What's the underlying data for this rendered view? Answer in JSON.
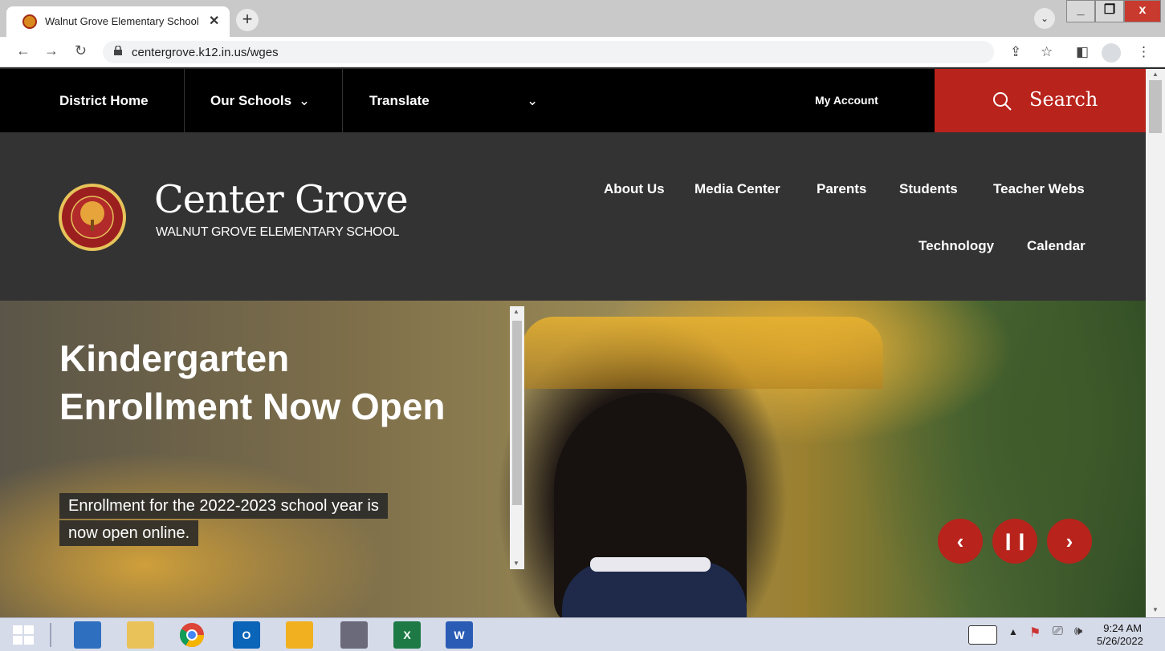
{
  "browser": {
    "tab_title": "Walnut Grove Elementary School",
    "tab_close": "✕",
    "new_tab": "+",
    "url": "centergrove.k12.in.us/wges"
  },
  "topbar": {
    "district_home": "District Home",
    "our_schools": "Our Schools",
    "translate": "Translate",
    "my_account": "My Account",
    "search": "Search"
  },
  "header": {
    "brand": "Center Grove",
    "subtitle": "WALNUT GROVE ELEMENTARY SCHOOL",
    "nav": {
      "about_us": "About Us",
      "media_center": "Media Center",
      "parents": "Parents",
      "students": "Students",
      "teacher_webs": "Teacher Webs",
      "technology": "Technology",
      "calendar": "Calendar"
    }
  },
  "hero": {
    "title": "Kindergarten Enrollment Now Open",
    "line1": "Enrollment for the 2022-2023 school year is",
    "line2": "now open online."
  },
  "taskbar": {
    "time": "9:24 AM",
    "date": "5/26/2022"
  },
  "colors": {
    "accent": "#b8231c",
    "topbar": "#000000",
    "header": "#333333"
  }
}
